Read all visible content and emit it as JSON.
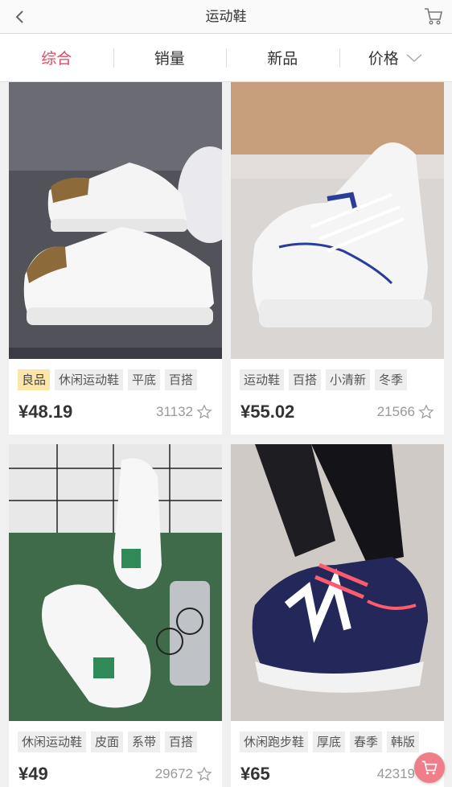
{
  "header": {
    "title": "运动鞋",
    "back_icon": "chevron-left-icon",
    "cart_icon": "cart-icon"
  },
  "tabs": [
    {
      "label": "综合",
      "active": true
    },
    {
      "label": "销量",
      "active": false
    },
    {
      "label": "新品",
      "active": false
    },
    {
      "label": "价格",
      "active": false,
      "icon": "chevron-down-icon"
    }
  ],
  "products": [
    {
      "tags": [
        "良品",
        "休闲运动鞋",
        "平底",
        "百搭"
      ],
      "highlight_tag": "良品",
      "price": "¥48.19",
      "sales": "31132"
    },
    {
      "tags": [
        "运动鞋",
        "百搭",
        "小清新",
        "冬季"
      ],
      "price": "¥55.02",
      "sales": "21566"
    },
    {
      "tags": [
        "休闲运动鞋",
        "皮面",
        "系带",
        "百搭"
      ],
      "price": "¥49",
      "sales": "29672"
    },
    {
      "tags": [
        "休闲跑步鞋",
        "厚底",
        "春季",
        "韩版"
      ],
      "price": "¥65",
      "sales": "42319"
    }
  ],
  "colors": {
    "accent": "#e04a5f",
    "highlight_tag_bg": "#fde6a9",
    "float_cart": "#f07d8a"
  }
}
